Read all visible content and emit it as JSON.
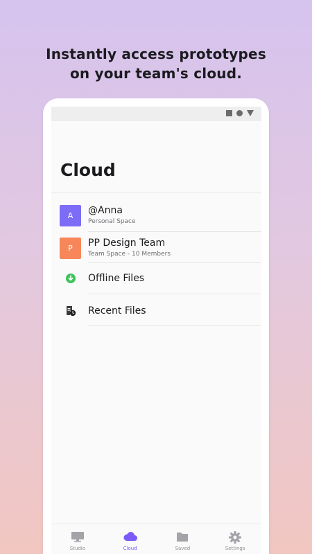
{
  "headline": {
    "line1": "Instantly access prototypes",
    "line2": "on your team's cloud."
  },
  "screen": {
    "title": "Cloud",
    "items": [
      {
        "avatar_letter": "A",
        "avatar_color": "#7c6cf6",
        "label": "@Anna",
        "sublabel": "Personal Space"
      },
      {
        "avatar_letter": "P",
        "avatar_color": "#f7875a",
        "label": "PP Design Team",
        "sublabel": "Team Space - 10 Members"
      },
      {
        "icon": "download-circle-icon",
        "icon_color": "#3ec45a",
        "label": "Offline Files"
      },
      {
        "icon": "recent-files-icon",
        "label": "Recent Files"
      }
    ],
    "tabs": [
      {
        "label": "Studio",
        "icon": "monitor-icon",
        "active": false
      },
      {
        "label": "Cloud",
        "icon": "cloud-icon",
        "active": true
      },
      {
        "label": "Saved",
        "icon": "folder-icon",
        "active": false
      },
      {
        "label": "Settings",
        "icon": "gear-icon",
        "active": false
      }
    ]
  },
  "colors": {
    "accent": "#7a5af8",
    "tab_inactive": "#a3a3a8"
  }
}
